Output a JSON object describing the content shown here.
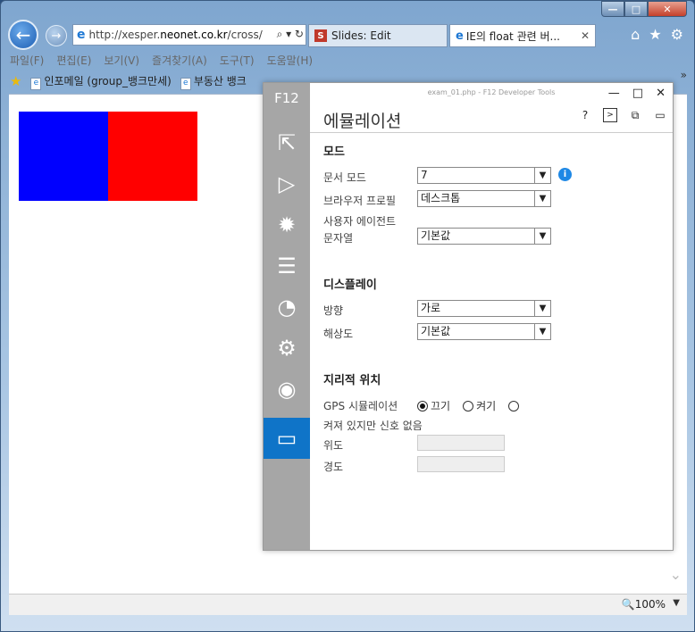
{
  "browser": {
    "address": {
      "prefix": "http://xesper.",
      "domain": "neonet.co.kr",
      "suffix": "/cross/",
      "tools": "⌕ ▾ ↻"
    },
    "tabs": [
      {
        "icon_letter": "S",
        "label": "Slides: Edit"
      },
      {
        "label": "IE의 float 관련 버...",
        "close": "✕"
      }
    ],
    "menu": [
      "파일(F)",
      "편집(E)",
      "보기(V)",
      "즐겨찾기(A)",
      "도구(T)",
      "도움말(H)"
    ],
    "favorites": [
      {
        "label": "인포메일 (group_뱅크만세)"
      },
      {
        "label": "부동산 뱅크"
      }
    ],
    "fav_more": "»",
    "zoom": "🔍100%",
    "zoom_arrow": "▼",
    "window_buttons": {
      "minimize": "—",
      "maximize": "□",
      "close": "✕"
    },
    "top_icons": {
      "home": "⌂",
      "favorites": "★",
      "settings": "⚙"
    },
    "colors": {
      "left_box": "#0000ff",
      "right_box": "#ff0000",
      "active_panel": "#0f74c8"
    }
  },
  "devtools": {
    "side_label": "F12",
    "title": "exam_01.php - F12 Developer Tools",
    "heading": "에뮬레이션",
    "toolbar": {
      "help": "?",
      "console": ">",
      "dock": "⧉",
      "undock": "▭"
    },
    "window_buttons": {
      "minimize": "—",
      "maximize": "□",
      "close": "✕"
    },
    "side_icons": [
      "dom-explorer-icon",
      "console-icon",
      "debugger-icon",
      "network-icon",
      "performance-icon",
      "memory-icon",
      "profiler-icon",
      "emulation-icon"
    ],
    "mode": {
      "section": "모드",
      "doc_mode_label": "문서 모드",
      "doc_mode_value": "7",
      "browser_profile_label": "브라우저 프로필",
      "browser_profile_value": "데스크톱",
      "ua_label_1": "사용자 에이전트",
      "ua_label_2": "문자열",
      "ua_value": "기본값"
    },
    "display": {
      "section": "디스플레이",
      "orientation_label": "방향",
      "orientation_value": "가로",
      "resolution_label": "해상도",
      "resolution_value": "기본값"
    },
    "geo": {
      "section": "지리적 위치",
      "gps_label": "GPS 시뮬레이션",
      "option_off": "끄기",
      "option_on": "켜기",
      "option_no_signal": "켜져 있지만 신호 없음",
      "selected": "끄기",
      "latitude_label": "위도",
      "longitude_label": "경도"
    }
  }
}
